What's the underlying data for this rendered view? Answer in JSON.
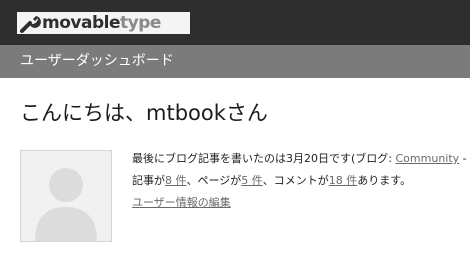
{
  "header": {
    "logo_left": "movable",
    "logo_right": "type"
  },
  "subheader": {
    "title": "ユーザーダッシュボード"
  },
  "greeting": "こんにちは、mtbookさん",
  "profile": {
    "avatar_icon": "default-user-avatar",
    "line1_prefix": "最後にブログ記事を書いたのは3月20日です(ブログ: ",
    "blog_link": "Community",
    "line1_suffix": " -",
    "line2_a": "記事が",
    "entries_link": "8 件",
    "line2_b": "、ページが",
    "pages_link": "5 件",
    "line2_c": "、コメントが",
    "comments_link": "18 件",
    "line2_d": "あります。",
    "edit_link": "ユーザー情報の編集"
  },
  "colors": {
    "topbar": "#2e2e2e",
    "subbar": "#7b7b7b",
    "link": "#6a6a6a"
  }
}
